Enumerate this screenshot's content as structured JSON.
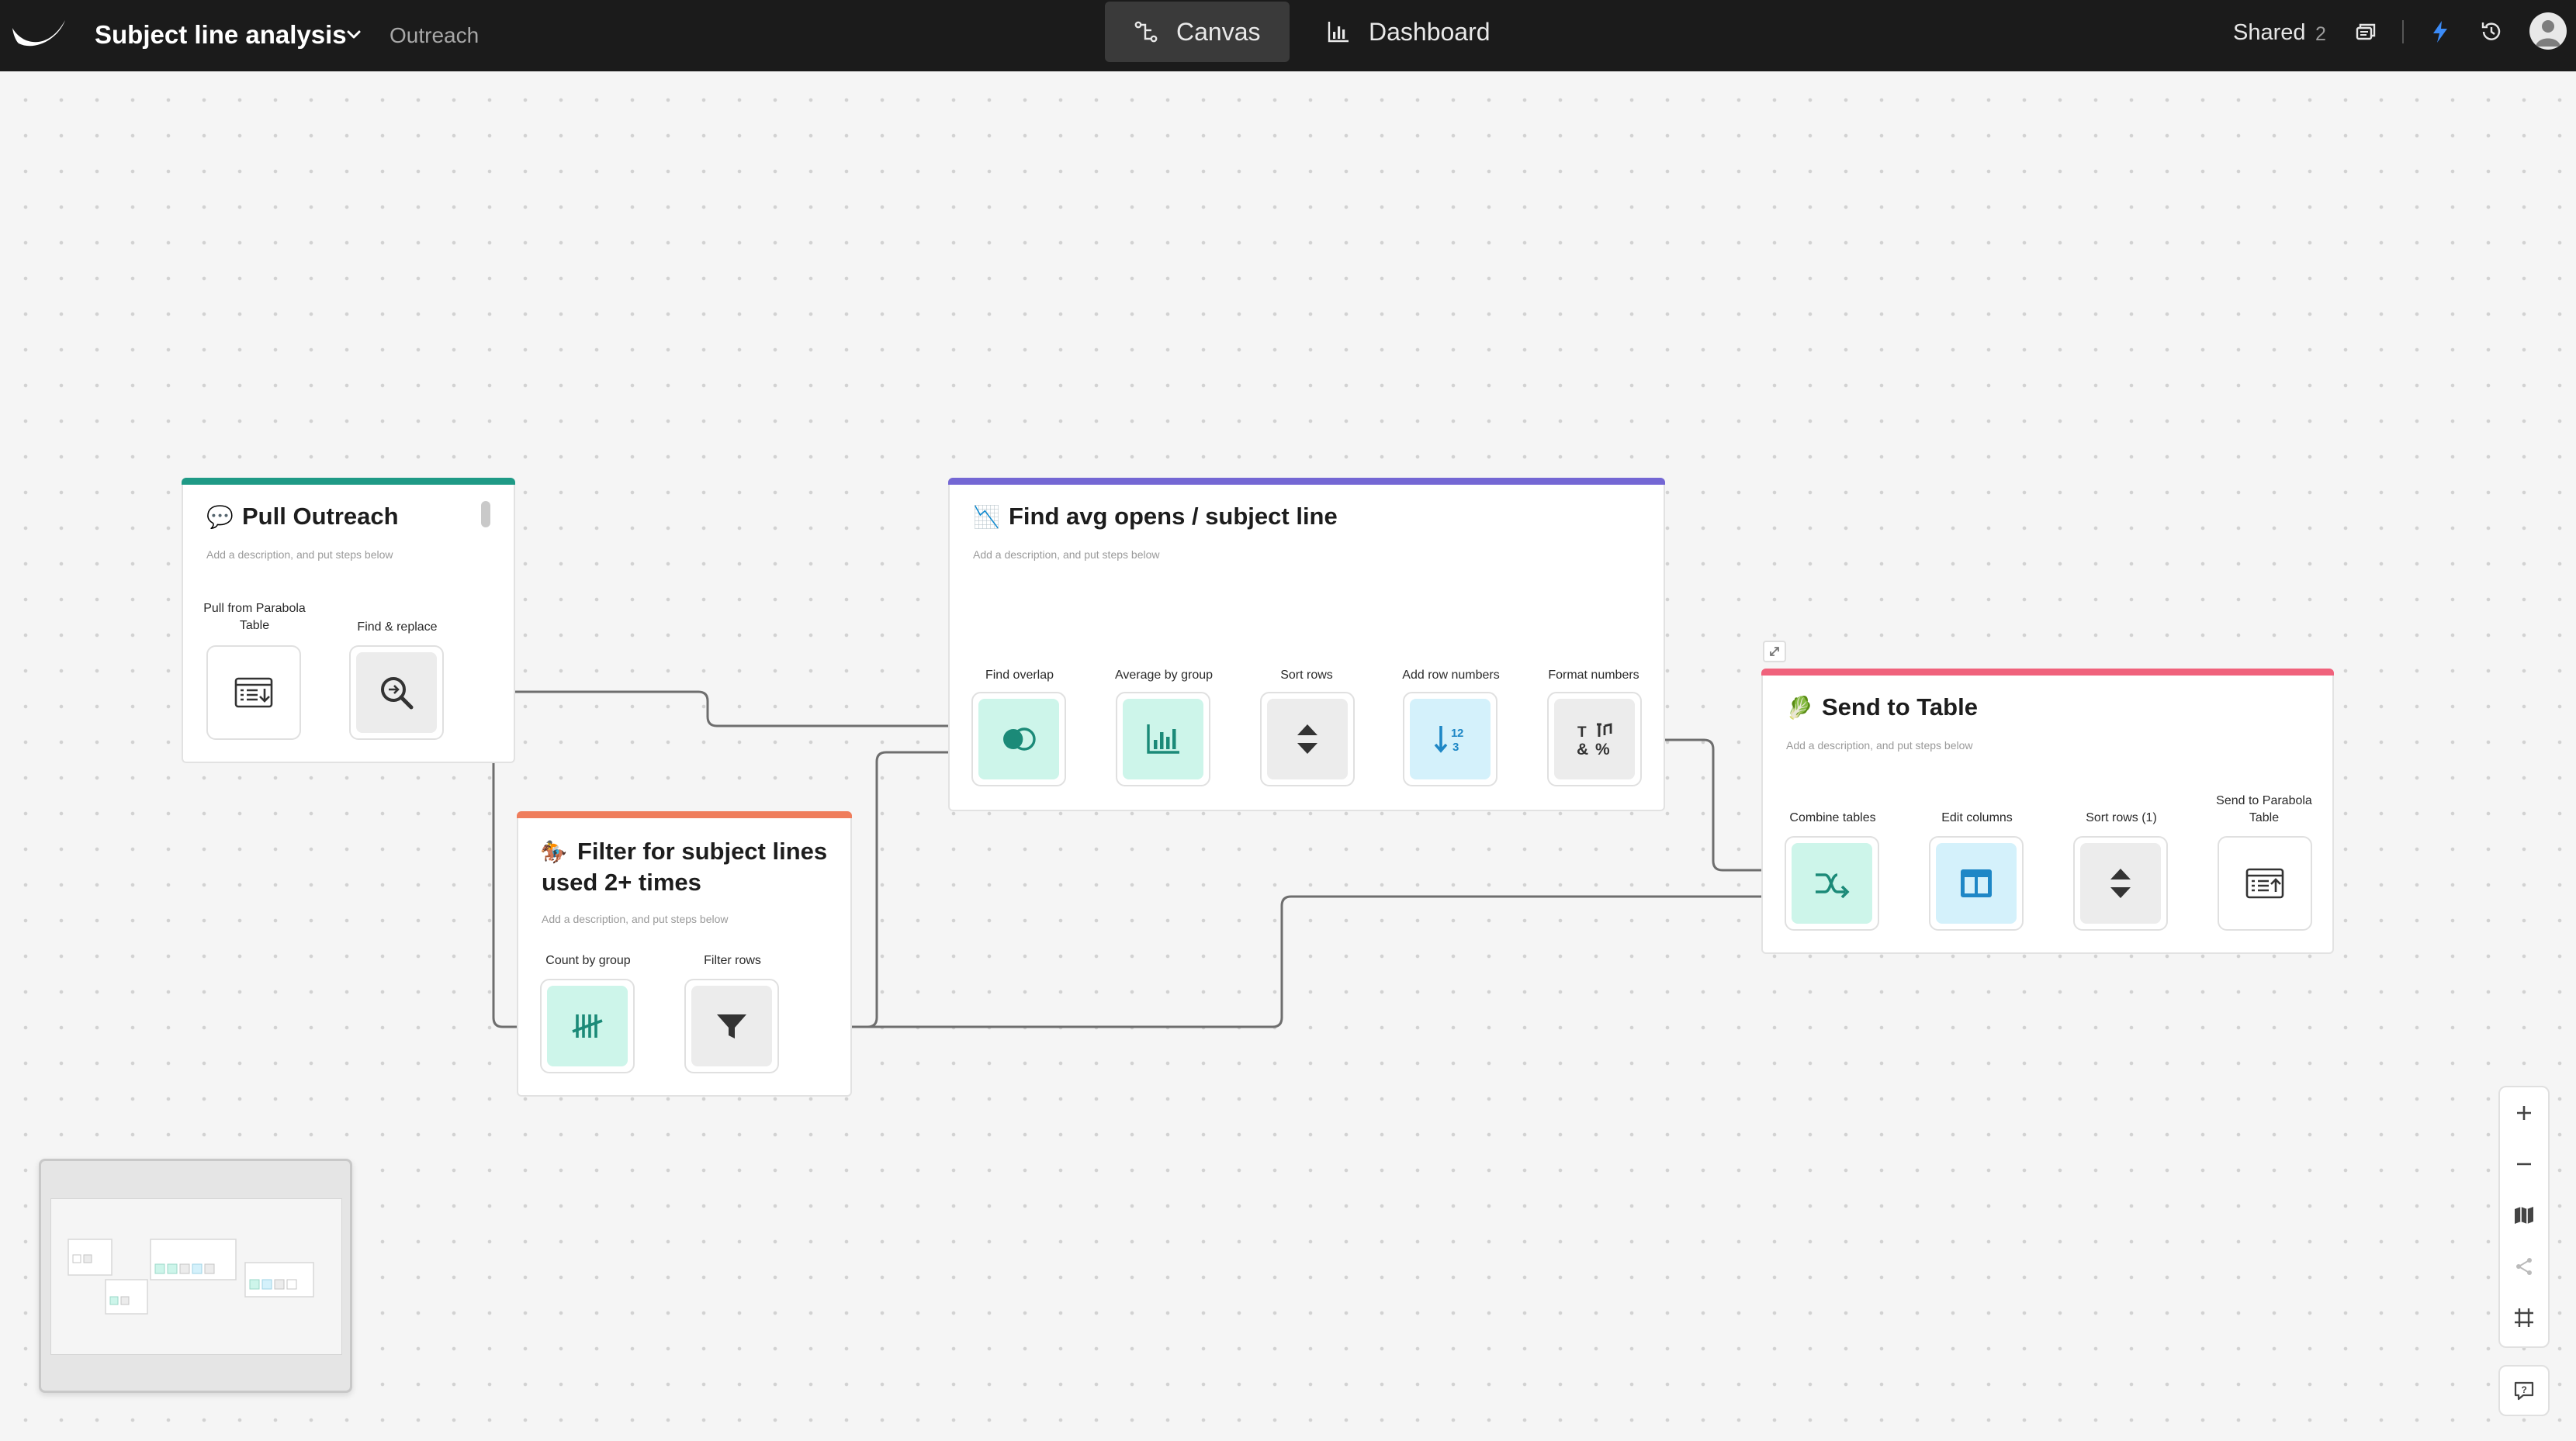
{
  "header": {
    "project_title": "Subject line analysis",
    "project_folder": "Outreach",
    "tabs": [
      {
        "label": "Canvas",
        "icon": "flow-icon",
        "active": true
      },
      {
        "label": "Dashboard",
        "icon": "bar-chart-icon",
        "active": false
      }
    ],
    "shared_label": "Shared",
    "shared_count": "2",
    "icons": [
      "layers-icon",
      "lightning-icon",
      "history-icon",
      "user-avatar-icon"
    ]
  },
  "colors": {
    "pull_outreach": "#1f9a86",
    "find_avg": "#7467d4",
    "filter": "#ef7d5c",
    "send_to_table": "#f0627c",
    "teal_tile": "#cdf5ea",
    "blue_tile": "#d4f1fb",
    "gray_tile": "#ececec"
  },
  "cards": {
    "pull_outreach": {
      "emoji": "💬",
      "title": "Pull Outreach",
      "description": "Add a description, and put steps below",
      "steps": [
        {
          "label": "Pull from Parabola\nTable",
          "icon": "table-import-icon"
        },
        {
          "label": "Find & replace",
          "icon": "magnifier-icon"
        }
      ]
    },
    "filter": {
      "emoji": "🏇",
      "title_line1": "Filter for subject lines",
      "title_line2": "used 2+ times",
      "description": "Add a description, and put steps below",
      "steps": [
        {
          "label": "Count by group",
          "icon": "tally-icon"
        },
        {
          "label": "Filter rows",
          "icon": "funnel-icon"
        }
      ]
    },
    "find_avg": {
      "emoji": "📉",
      "title": "Find avg opens / subject line",
      "description": "Add a description, and put steps below",
      "steps": [
        {
          "label": "Find overlap",
          "icon": "overlap-icon"
        },
        {
          "label": "Average by group",
          "icon": "bar-chart-icon"
        },
        {
          "label": "Sort rows",
          "icon": "sort-icon"
        },
        {
          "label": "Add row numbers",
          "icon": "row-numbers-icon"
        },
        {
          "label": "Format numbers",
          "icon": "format-numbers-icon"
        }
      ]
    },
    "send_to_table": {
      "emoji": "🥬",
      "title": "Send to Table",
      "description": "Add a description, and put steps below",
      "steps": [
        {
          "label": "Combine tables",
          "icon": "combine-icon"
        },
        {
          "label": "Edit columns",
          "icon": "columns-icon"
        },
        {
          "label": "Sort rows (1)",
          "icon": "sort-icon"
        },
        {
          "label": "Send to Parabola\nTable",
          "icon": "table-export-icon"
        }
      ]
    }
  },
  "controls": {
    "zoom": [
      "zoom-in-icon",
      "zoom-out-icon",
      "map-icon",
      "tidy-icon",
      "fit-frame-icon"
    ],
    "help": "help-chat-icon"
  }
}
